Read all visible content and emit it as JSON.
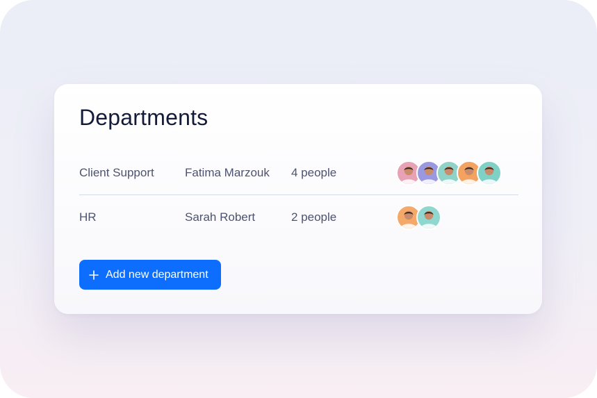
{
  "card": {
    "title": "Departments"
  },
  "departments": [
    {
      "name": "Client Support",
      "lead": "Fatima Marzouk",
      "count": "4 people",
      "avatars": [
        {
          "icon": "avatar-person-icon",
          "bg": "#e8a2b6"
        },
        {
          "icon": "avatar-person-icon",
          "bg": "#9a98e0"
        },
        {
          "icon": "avatar-person-icon",
          "bg": "#8fd3c8"
        },
        {
          "icon": "avatar-person-icon",
          "bg": "#f3a35f"
        },
        {
          "icon": "avatar-person-icon",
          "bg": "#7fd1c6"
        }
      ]
    },
    {
      "name": "HR",
      "lead": "Sarah Robert",
      "count": "2 people",
      "avatars": [
        {
          "icon": "avatar-person-icon",
          "bg": "#f4a86a"
        },
        {
          "icon": "avatar-person-icon",
          "bg": "#8fd7cf"
        }
      ]
    }
  ],
  "actions": {
    "add_label": "Add new department",
    "add_icon": "plus-icon"
  },
  "colors": {
    "accent": "#0d6efd",
    "title": "#141a3a",
    "text": "#4d5270",
    "divider": "#d6dbe9"
  }
}
